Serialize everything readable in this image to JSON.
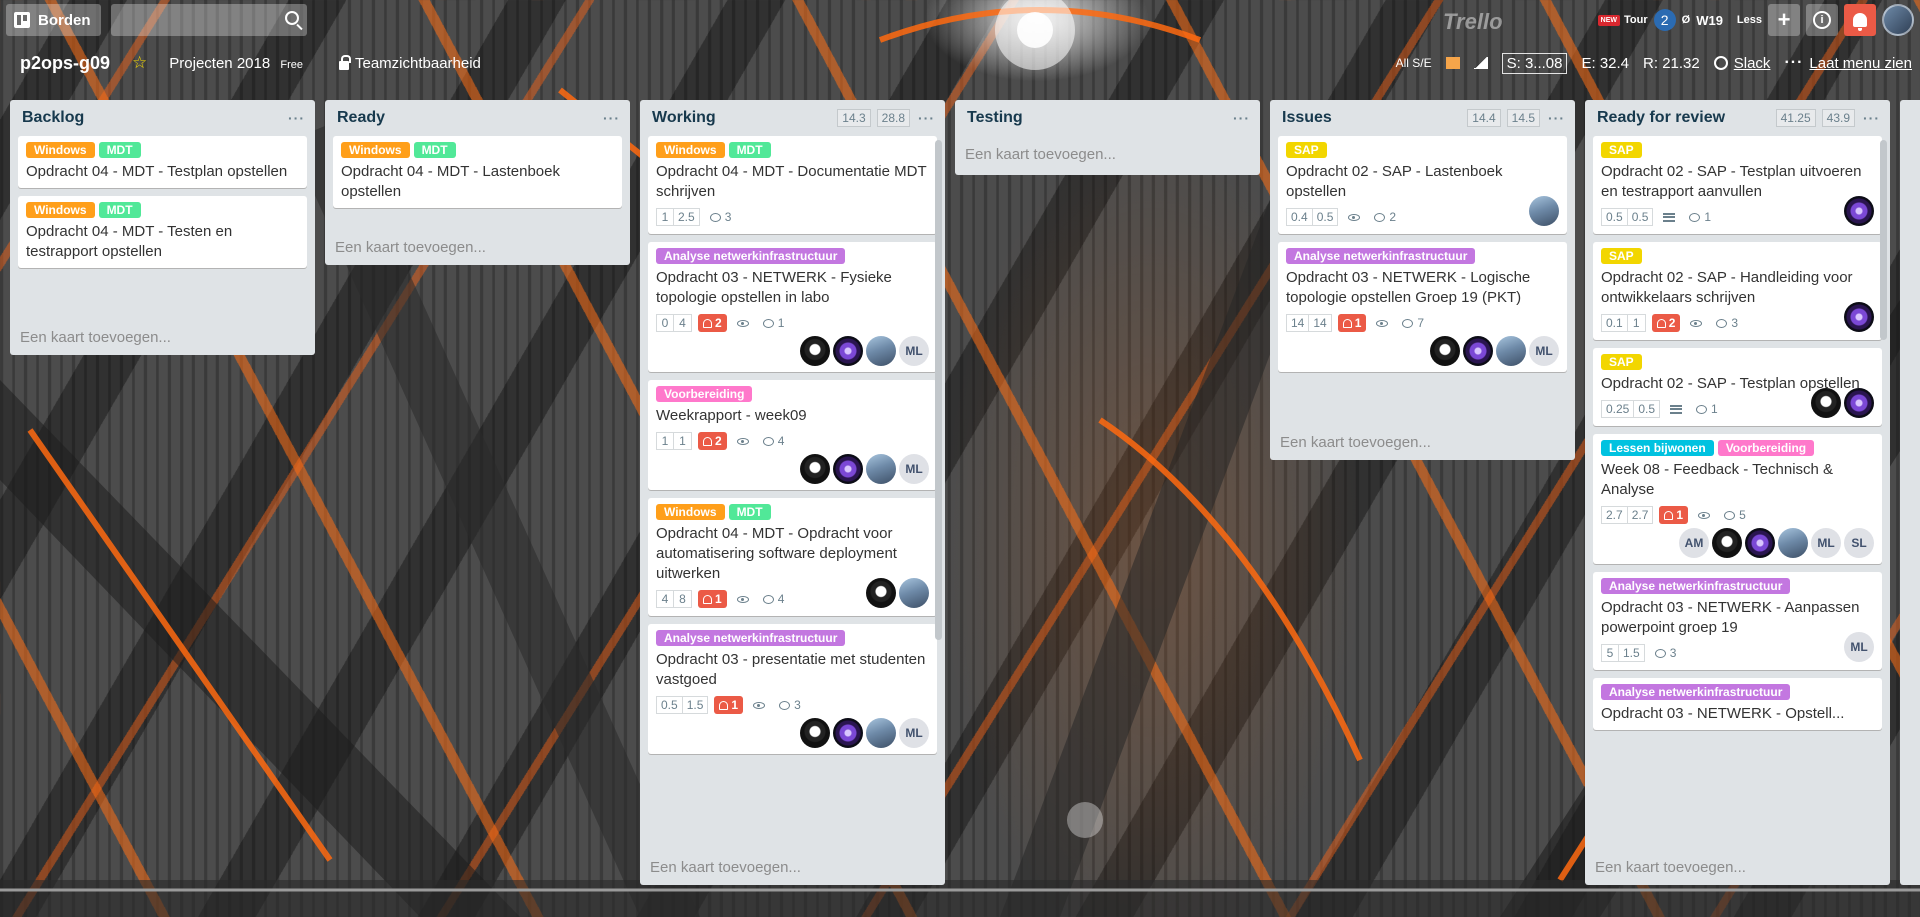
{
  "header": {
    "boards_label": "Borden",
    "search_value": "",
    "logo_text": "Trello",
    "ext": {
      "new_badge": "NEW",
      "tour_label": "Tour",
      "zero_symbol": "Ø",
      "week_label": "W19",
      "less_label": "Less"
    },
    "add_symbol": "+",
    "info_symbol": "i"
  },
  "board": {
    "title": "p2ops-g09",
    "team": "Projecten 2018",
    "team_badge": "Free",
    "visibility": "Teamzichtbaarheid",
    "filter": "All S/E",
    "stat_s": "S: 3...08",
    "stat_e": "E: 32.4",
    "stat_r": "R: 21.32",
    "slack": "Slack",
    "show_menu": "Laat menu zien"
  },
  "colors": {
    "orange": "#ff9f1a",
    "green": "#51e898",
    "yellow": "#f2d600",
    "purple": "#c377e0",
    "pink": "#ff78cb",
    "sky": "#00c2e0",
    "red": "#eb5a46"
  },
  "lists": [
    {
      "title": "Backlog",
      "footer": "Een kaart toevoegen...",
      "cards": [
        {
          "labels": [
            {
              "text": "Windows",
              "color": "#ff9f1a"
            },
            {
              "text": "MDT",
              "color": "#51e898"
            }
          ],
          "title": "Opdracht 04 - MDT - Testplan opstellen"
        },
        {
          "labels": [
            {
              "text": "Windows",
              "color": "#ff9f1a"
            },
            {
              "text": "MDT",
              "color": "#51e898"
            }
          ],
          "title": "Opdracht 04 - MDT - Testen en testrapport opstellen"
        }
      ]
    },
    {
      "title": "Ready",
      "footer": "Een kaart toevoegen...",
      "cards": [
        {
          "labels": [
            {
              "text": "Windows",
              "color": "#ff9f1a"
            },
            {
              "text": "MDT",
              "color": "#51e898"
            }
          ],
          "title": "Opdracht 04 - MDT - Lastenboek opstellen"
        }
      ]
    },
    {
      "title": "Working",
      "stats": [
        "14.3",
        "28.8"
      ],
      "footer": "Een kaart toevoegen...",
      "cards": [
        {
          "labels": [
            {
              "text": "Windows",
              "color": "#ff9f1a"
            },
            {
              "text": "MDT",
              "color": "#51e898"
            }
          ],
          "title": "Opdracht 04 - MDT - Documentatie MDT schrijven",
          "nums": [
            "1",
            "2.5"
          ],
          "comments": "3"
        },
        {
          "labels": [
            {
              "text": "Analyse netwerkinfrastructuur",
              "color": "#c377e0"
            }
          ],
          "title": "Opdracht 03 - NETWERK - Fysieke topologie opstellen in labo",
          "nums": [
            "0",
            "4"
          ],
          "due": "2",
          "watch": true,
          "comments": "1",
          "members": [
            "lion",
            "purple",
            "photo",
            "ML"
          ]
        },
        {
          "labels": [
            {
              "text": "Voorbereiding",
              "color": "#ff78cb"
            }
          ],
          "title": "Weekrapport - week09",
          "nums": [
            "1",
            "1"
          ],
          "due": "2",
          "watch": true,
          "comments": "4",
          "members": [
            "lion",
            "purple",
            "photo",
            "ML"
          ]
        },
        {
          "labels": [
            {
              "text": "Windows",
              "color": "#ff9f1a"
            },
            {
              "text": "MDT",
              "color": "#51e898"
            }
          ],
          "title": "Opdracht 04 - MDT - Opdracht voor automatisering software deployment uitwerken",
          "nums": [
            "4",
            "8"
          ],
          "due": "1",
          "watch": true,
          "comments": "4",
          "inline_members": [
            "lion",
            "photo"
          ]
        },
        {
          "labels": [
            {
              "text": "Analyse netwerkinfrastructuur",
              "color": "#c377e0"
            }
          ],
          "title": "Opdracht 03 - presentatie met studenten vastgoed",
          "nums": [
            "0.5",
            "1.5"
          ],
          "due": "1",
          "watch": true,
          "comments": "3",
          "members": [
            "lion",
            "purple",
            "photo",
            "ML"
          ]
        }
      ]
    },
    {
      "title": "Testing",
      "footer": "Een kaart toevoegen...",
      "cards": []
    },
    {
      "title": "Issues",
      "stats": [
        "14.4",
        "14.5"
      ],
      "footer": "Een kaart toevoegen...",
      "cards": [
        {
          "labels": [
            {
              "text": "SAP",
              "color": "#f2d600"
            }
          ],
          "title": "Opdracht 02 - SAP - Lastenboek opstellen",
          "nums": [
            "0.4",
            "0.5"
          ],
          "watch": true,
          "comments": "2",
          "inline_members": [
            "photo"
          ]
        },
        {
          "labels": [
            {
              "text": "Analyse netwerkinfrastructuur",
              "color": "#c377e0"
            }
          ],
          "title": "Opdracht 03 - NETWERK - Logische topologie opstellen Groep 19 (PKT)",
          "nums": [
            "14",
            "14"
          ],
          "due": "1",
          "watch": true,
          "comments": "7",
          "members": [
            "lion",
            "purple",
            "photo",
            "ML"
          ]
        }
      ]
    },
    {
      "title": "Ready for review",
      "stats": [
        "41.25",
        "43.9"
      ],
      "footer": "Een kaart toevoegen...",
      "cards": [
        {
          "labels": [
            {
              "text": "SAP",
              "color": "#f2d600"
            }
          ],
          "title": "Opdracht 02 - SAP - Testplan uitvoeren en testrapport aanvullen",
          "nums": [
            "0.5",
            "0.5"
          ],
          "desc": true,
          "comments": "1",
          "inline_members": [
            "purple"
          ]
        },
        {
          "labels": [
            {
              "text": "SAP",
              "color": "#f2d600"
            }
          ],
          "title": "Opdracht 02 - SAP - Handleiding voor ontwikkelaars schrijven",
          "nums": [
            "0.1",
            "1"
          ],
          "due": "2",
          "watch": true,
          "comments": "3",
          "inline_members": [
            "purple"
          ]
        },
        {
          "labels": [
            {
              "text": "SAP",
              "color": "#f2d600"
            }
          ],
          "title": "Opdracht 02 - SAP - Testplan opstellen",
          "nums": [
            "0.25",
            "0.5"
          ],
          "desc": true,
          "comments": "1",
          "inline_members": [
            "lion",
            "purple"
          ]
        },
        {
          "labels": [
            {
              "text": "Lessen bijwonen",
              "color": "#00c2e0"
            },
            {
              "text": "Voorbereiding",
              "color": "#ff78cb"
            }
          ],
          "title": "Week 08 - Feedback - Technisch & Analyse",
          "nums": [
            "2.7",
            "2.7"
          ],
          "due": "1",
          "watch": true,
          "comments": "5",
          "members": [
            "AM",
            "lion",
            "purple",
            "photo",
            "ML",
            "SL"
          ]
        },
        {
          "labels": [
            {
              "text": "Analyse netwerkinfrastructuur",
              "color": "#c377e0"
            }
          ],
          "title": "Opdracht 03 - NETWERK - Aanpassen powerpoint groep 19",
          "nums": [
            "5",
            "1.5"
          ],
          "comments": "3",
          "inline_members": [
            "ML"
          ]
        },
        {
          "labels": [
            {
              "text": "Analyse netwerkinfrastructuur",
              "color": "#c377e0"
            }
          ],
          "title": "Opdracht 03 - NETWERK - Opstell..."
        }
      ]
    }
  ]
}
